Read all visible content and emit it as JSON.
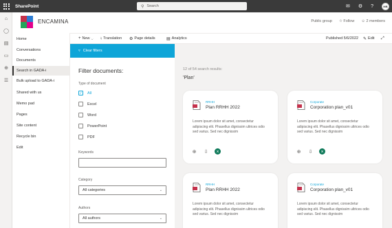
{
  "suite": {
    "brand": "SharePoint",
    "search_placeholder": "Search",
    "user_initials": "MB"
  },
  "site": {
    "title": "ENCAMINA",
    "public_group": "Public group",
    "follow": "Follow",
    "members": "2 members"
  },
  "commandbar": {
    "new": "New",
    "translation": "Translation",
    "page_details": "Page details",
    "analytics": "Analytics",
    "published": "Published 5/6/2022",
    "edit": "Edit"
  },
  "nav": {
    "items": [
      {
        "label": "Home"
      },
      {
        "label": "Conversations"
      },
      {
        "label": "Documents"
      },
      {
        "label": "Search in GADA-i"
      },
      {
        "label": "Bulk upload to GADA-i"
      },
      {
        "label": "Shared with us"
      },
      {
        "label": "Memo pad"
      },
      {
        "label": "Pages"
      },
      {
        "label": "Site content"
      },
      {
        "label": "Recycle bin"
      },
      {
        "label": "Edit"
      }
    ],
    "active": "Search in GADA-i"
  },
  "filters": {
    "clear_label": "Clear filters",
    "title": "Filter documents:",
    "type_label": "Type of document",
    "types": [
      {
        "label": "All",
        "checked": true
      },
      {
        "label": "Excel",
        "checked": false
      },
      {
        "label": "Word",
        "checked": false
      },
      {
        "label": "PowerPoint",
        "checked": false
      },
      {
        "label": "PDF",
        "checked": false
      }
    ],
    "keywords_label": "Keywords",
    "keywords_value": "",
    "category_label": "Category",
    "category_value": "All categories",
    "authors_label": "Authors",
    "authors_value": "All authors"
  },
  "results": {
    "count_text": "12 of 54 search results:",
    "query_text": "'Plan'",
    "cards": [
      {
        "category": "RRHH",
        "title": "Plan RRHH 2022",
        "description": "Lorem ipsum dolor sit amet, consectetur adipiscing elit. Phasellus dignissim ultrices odio sed varius. Sed nec dignissim"
      },
      {
        "category": "Corporate",
        "title": "Corporation plan_v01",
        "description": "Lorem ipsum dolor sit amet, consectetur adipiscing elit. Phasellus dignissim ultrices odio sed varius. Sed nec dignissim"
      },
      {
        "category": "RRHH",
        "title": "Plan RRHH 2022",
        "description": "Lorem ipsum dolor sit amet, consectetur adipiscing elit. Phasellus dignissim ultrices odio sed varius. Sed nec dignissim"
      },
      {
        "category": "Corporate",
        "title": "Corporation plan_v01",
        "description": "Lorem ipsum dolor sit amet, consectetur adipiscing elit. Phasellus dignissim ultrices odio sed varius. Sed nec dignissim"
      }
    ]
  },
  "colors": {
    "accent": "#0ea5d8",
    "suitebar": "#3a3a3a",
    "excel": "#0f7a5a",
    "pdf_red": "#c4314b"
  }
}
